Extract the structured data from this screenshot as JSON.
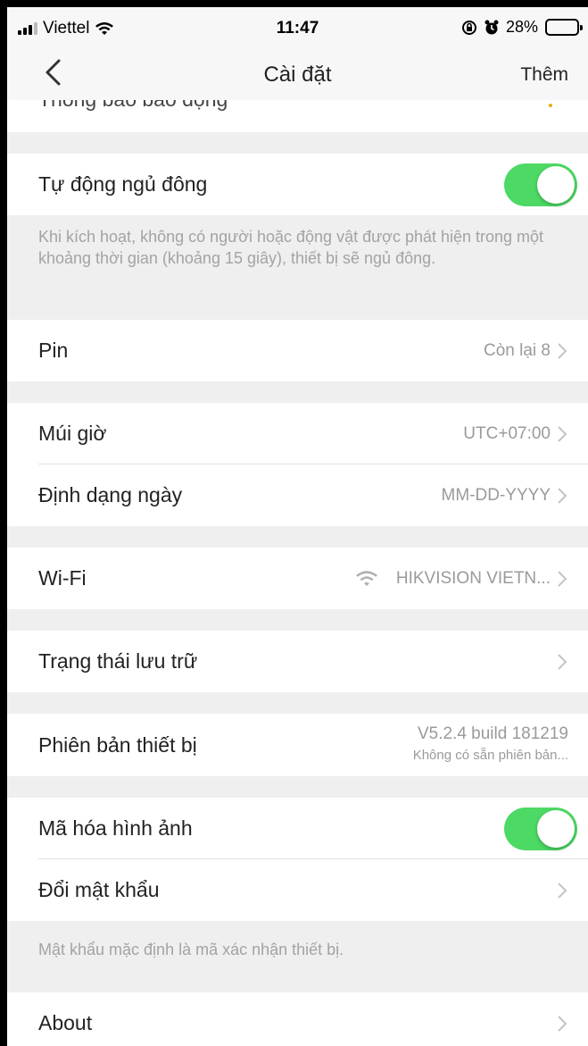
{
  "status_bar": {
    "carrier": "Viettel",
    "time": "11:47",
    "battery": "28%",
    "battery_level": 0.28
  },
  "nav": {
    "title": "Cài đặt",
    "right_action": "Thêm"
  },
  "partial_row": {
    "label": "Thông báo báo động"
  },
  "hibernate": {
    "label": "Tự động ngủ đông",
    "enabled": true,
    "note": "Khi kích hoạt, không có người hoặc động vật được phát hiện trong một khoảng thời gian (khoảng 15 giây), thiết bị sẽ ngủ đông."
  },
  "battery_row": {
    "label": "Pin",
    "value": "Còn lại 8"
  },
  "timezone_row": {
    "label": "Múi giờ",
    "value": "UTC+07:00"
  },
  "date_format_row": {
    "label": "Định dạng ngày",
    "value": "MM-DD-YYYY"
  },
  "wifi_row": {
    "label": "Wi-Fi",
    "value": "HIKVISION VIETN...",
    "icon": "wifi-icon"
  },
  "storage_row": {
    "label": "Trạng thái lưu trữ"
  },
  "version_row": {
    "label": "Phiên bản thiết bị",
    "version": "V5.2.4 build 181219",
    "update_status": "Không có sẵn phiên bản..."
  },
  "encryption_row": {
    "label": "Mã hóa hình ảnh",
    "enabled": true
  },
  "password_row": {
    "label": "Đổi mật khẩu"
  },
  "password_note": "Mật khẩu mặc định là mã xác nhận thiết bị.",
  "about_row": {
    "label": "About"
  },
  "colors": {
    "toggle_on": "#4cd964",
    "background": "#efefef"
  }
}
